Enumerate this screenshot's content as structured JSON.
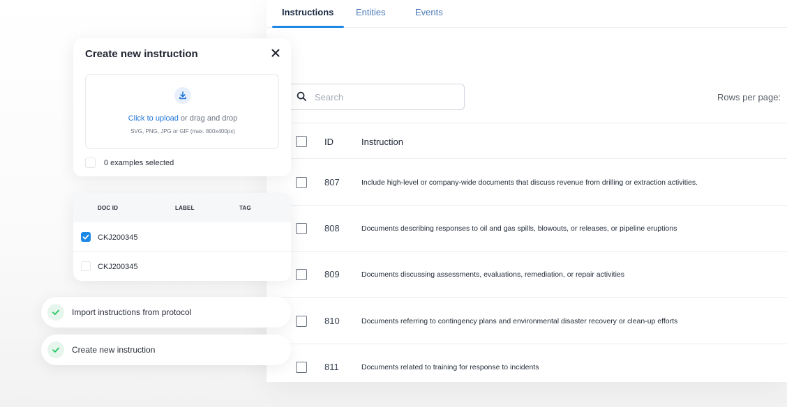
{
  "tabs": [
    {
      "label": "Instructions",
      "active": true
    },
    {
      "label": "Entities",
      "active": false
    },
    {
      "label": "Events",
      "active": false
    }
  ],
  "search": {
    "placeholder": "Search",
    "icon": "search-icon"
  },
  "rows_per_page_label": "Rows per page:",
  "table": {
    "headers": {
      "id": "ID",
      "instruction": "Instruction"
    },
    "rows": [
      {
        "id": "807",
        "instruction": "Include high-level or company-wide documents that discuss revenue from drilling or extraction activities."
      },
      {
        "id": "808",
        "instruction": "Documents describing responses to oil and gas spills, blowouts, or releases, or pipeline eruptions"
      },
      {
        "id": "809",
        "instruction": "Documents discussing assessments, evaluations, remediation, or repair activities"
      },
      {
        "id": "810",
        "instruction": "Documents referring to contingency plans and environmental disaster recovery or clean-up efforts"
      },
      {
        "id": "811",
        "instruction": "Documents related to training for response to incidents"
      }
    ]
  },
  "create_dialog": {
    "title": "Create new instruction",
    "upload_link": "Click to upload",
    "upload_rest": " or drag and drop",
    "upload_hint": "SVG, PNG, JPG or GIF (max. 800x400px)",
    "examples_selected": "0 examples selected"
  },
  "docs_table": {
    "headers": {
      "doc_id": "DOC ID",
      "label": "LABEL",
      "tag": "TAG"
    },
    "rows": [
      {
        "doc_id": "CKJ200345",
        "checked": true
      },
      {
        "doc_id": "CKJ200345",
        "checked": false
      }
    ]
  },
  "actions": [
    {
      "label": "Import instructions from protocol"
    },
    {
      "label": "Create new instruction"
    }
  ],
  "colors": {
    "accent": "#1e88e5",
    "success": "#22c55e",
    "link": "#1e73d8"
  }
}
